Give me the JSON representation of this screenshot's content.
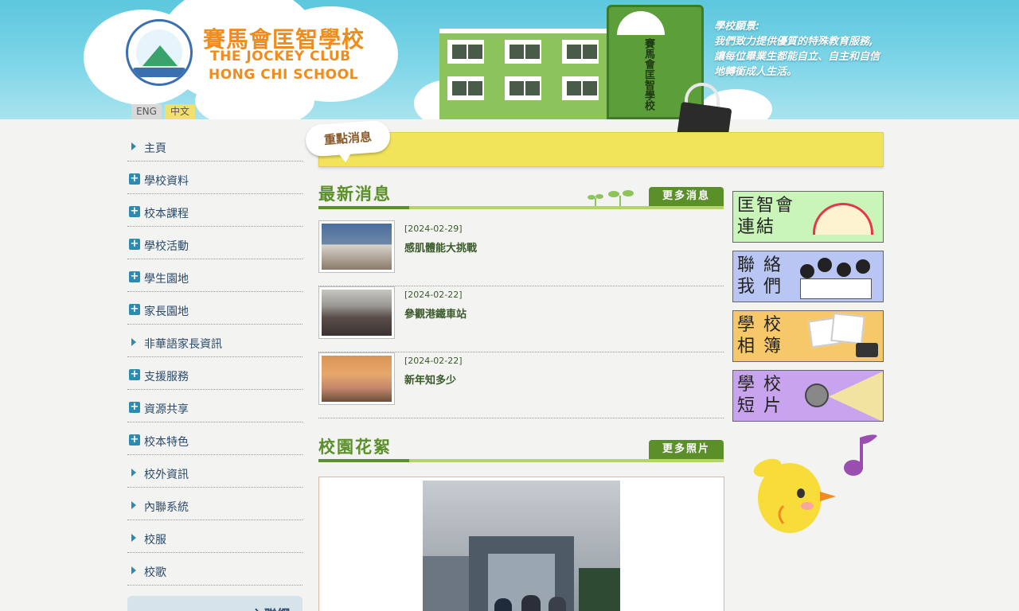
{
  "header": {
    "school_name_zh": "賽馬會匡智學校",
    "school_name_en_line1": "THE JOCKEY CLUB",
    "school_name_en_line2": "HONG CHI SCHOOL",
    "tower_sign": "賽馬會匡智學校",
    "vision_lines": [
      "學校願景:",
      "我們致力提供優質的特殊教育服務,",
      "讓每位畢業生都能自立、自主和自信",
      "地轉銜成人生活。"
    ],
    "lang_eng": "ENG",
    "lang_zh": "中文"
  },
  "nav": {
    "items": [
      {
        "label": "主頁",
        "icon": "arrow"
      },
      {
        "label": "學校資料",
        "icon": "plus"
      },
      {
        "label": "校本課程",
        "icon": "plus"
      },
      {
        "label": "學校活動",
        "icon": "plus"
      },
      {
        "label": "學生園地",
        "icon": "plus"
      },
      {
        "label": "家長園地",
        "icon": "plus"
      },
      {
        "label": "非華語家長資訊",
        "icon": "arrow"
      },
      {
        "label": "支援服務",
        "icon": "plus"
      },
      {
        "label": "資源共享",
        "icon": "plus"
      },
      {
        "label": "校本特色",
        "icon": "plus"
      },
      {
        "label": "校外資訊",
        "icon": "arrow"
      },
      {
        "label": "內聯系統",
        "icon": "arrow"
      },
      {
        "label": "校服",
        "icon": "arrow"
      },
      {
        "label": "校歌",
        "icon": "arrow"
      }
    ],
    "bottom_box_label": "入聯網"
  },
  "banner": {
    "bubble_label": "重點消息"
  },
  "news": {
    "section_title": "最新消息",
    "more_label": "更多消息",
    "items": [
      {
        "date": "[2024-02-29]",
        "title": "感肌體能大挑戰"
      },
      {
        "date": "[2024-02-22]",
        "title": "參觀港鐵車站"
      },
      {
        "date": "[2024-02-22]",
        "title": "新年知多少"
      }
    ]
  },
  "gallery": {
    "section_title": "校園花絮",
    "more_label": "更多照片"
  },
  "right_links": [
    {
      "line1": "匡智會",
      "line2": "連結",
      "bg": "#c9f5b8"
    },
    {
      "line1": "聯 絡",
      "line2": "我 們",
      "bg": "#b9c6f3"
    },
    {
      "line1": "學 校",
      "line2": "相 簿",
      "bg": "#f7c86a"
    },
    {
      "line1": "學 校",
      "line2": "短 片",
      "bg": "#c8a4ee"
    }
  ],
  "colors": {
    "accent_green": "#5a8f2a",
    "banner_yellow": "#f2e45a",
    "nav_blue": "#2d8bb0",
    "header_sky": "#5cc7dd"
  }
}
